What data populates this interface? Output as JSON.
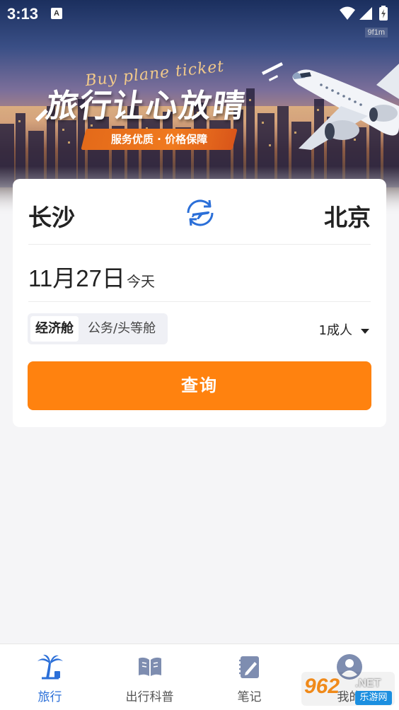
{
  "status_bar": {
    "time": "3:13",
    "notification_icon_letter": "A",
    "icons": [
      "wifi-icon",
      "cellular-signal-icon",
      "battery-charging-icon"
    ],
    "fps_badge": "9f1m"
  },
  "hero": {
    "script_text": "Buy plane ticket",
    "title": "旅行让心放晴",
    "tagline": "服务优质 · 价格保障"
  },
  "search_card": {
    "from_city": "长沙",
    "to_city": "北京",
    "swap_icon": "plane-swap-icon",
    "date": "11月27日",
    "date_note": "今天",
    "cabin_options": [
      {
        "label": "经济舱",
        "selected": true
      },
      {
        "label": "公务/头等舱",
        "selected": false
      }
    ],
    "passengers": "1成人",
    "search_label": "查询"
  },
  "bottom_nav": {
    "items": [
      {
        "label": "旅行",
        "icon": "palm-tree-icon",
        "active": true
      },
      {
        "label": "出行科普",
        "icon": "book-icon",
        "active": false
      },
      {
        "label": "笔记",
        "icon": "notebook-pen-icon",
        "active": false
      },
      {
        "label": "我的",
        "icon": "user-avatar-icon",
        "active": false
      }
    ]
  },
  "watermark": {
    "number": "962",
    "domain": ".NET",
    "site_name": "乐游网"
  },
  "colors": {
    "accent_orange": "#ff820f",
    "active_blue": "#2b6fd8",
    "ribbon_orange": "#e46a1a"
  }
}
